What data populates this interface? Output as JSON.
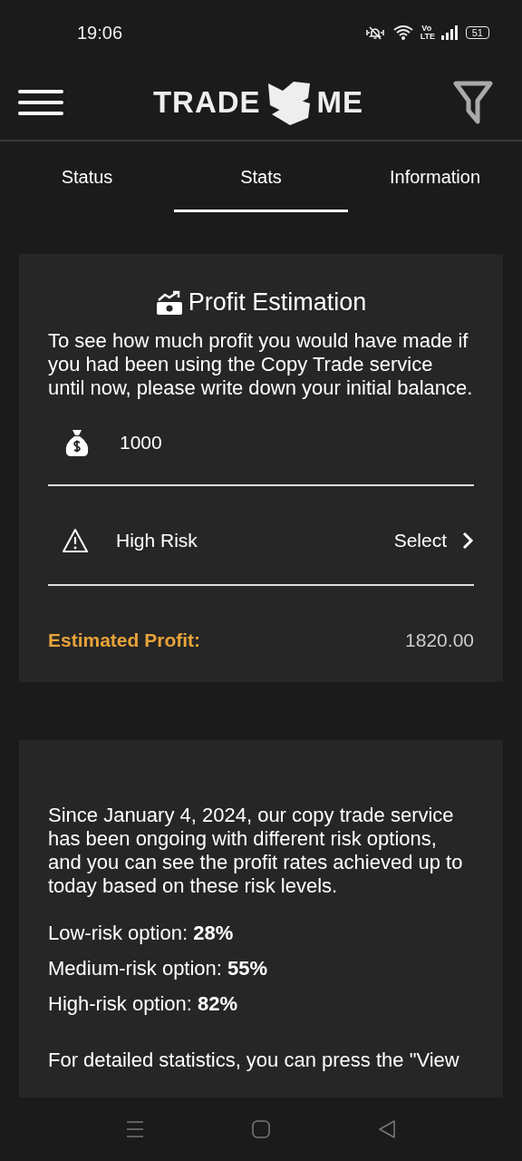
{
  "status_bar": {
    "time": "19:06",
    "network_label": "Vo LTE",
    "battery": "51"
  },
  "header": {
    "logo_left": "TRADE",
    "logo_right": "ME"
  },
  "tabs": [
    {
      "label": "Status",
      "selected": false
    },
    {
      "label": "Stats",
      "selected": true
    },
    {
      "label": "Information",
      "selected": false
    }
  ],
  "profit_card": {
    "title": "Profit Estimation",
    "description": "To see how much profit you would have made if you had been using the Copy Trade service until now, please write down your initial balance.",
    "balance": {
      "value": "1000"
    },
    "risk": {
      "value": "High Risk",
      "action": "Select"
    },
    "result": {
      "label": "Estimated Profit:",
      "value": "1820.00"
    }
  },
  "info_card": {
    "intro": "Since January 4, 2024, our copy trade service has been ongoing with different risk options, and you can see the profit rates achieved up to today based on these risk levels.",
    "options": [
      "Low-risk option: **28%**",
      "Medium-risk option: **55%**",
      "High-risk option: **82%**"
    ],
    "footer": "For detailed statistics, you can press the \"View"
  }
}
